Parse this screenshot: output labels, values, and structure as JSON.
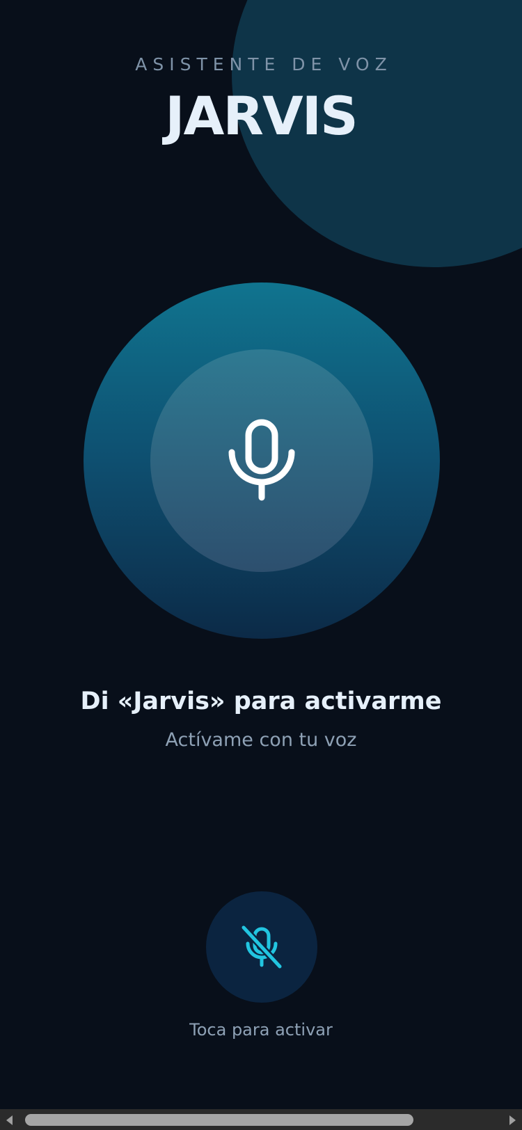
{
  "header": {
    "eyebrow": "ASISTENTE DE VOZ",
    "title": "JARVIS"
  },
  "orb": {
    "icon": "microphone-icon"
  },
  "prompt": {
    "title": "Di «Jarvis» para activarme",
    "subtitle": "Actívame con tu voz"
  },
  "activate": {
    "icon": "microphone-off-icon",
    "label": "Toca para activar"
  },
  "colors": {
    "background": "#080f1a",
    "accent": "#22c5e0",
    "title_text": "#e6f0fa",
    "muted_text": "#8ea1b5"
  }
}
